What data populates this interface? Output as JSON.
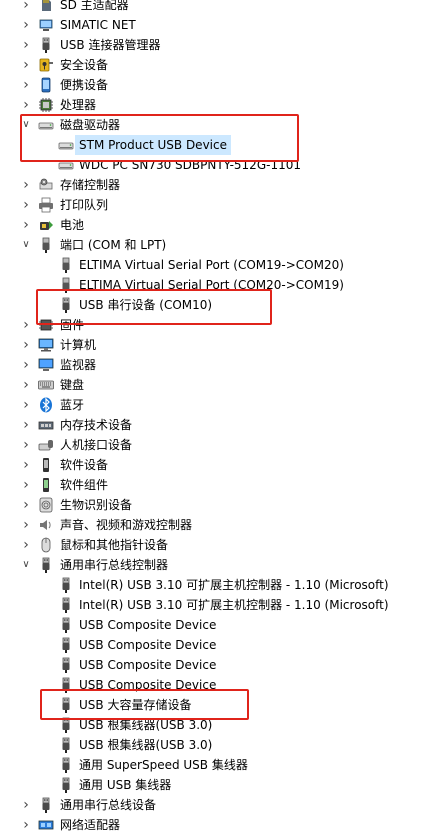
{
  "rows": [
    {
      "level": 0,
      "exp": "c",
      "icon": "sd-card-icon",
      "label": "SD 主适配器"
    },
    {
      "level": 0,
      "exp": "c",
      "icon": "network-icon",
      "label": "SIMATIC NET"
    },
    {
      "level": 0,
      "exp": "c",
      "icon": "usb-device-icon",
      "label": "USB 连接器管理器"
    },
    {
      "level": 0,
      "exp": "c",
      "icon": "security-key-icon",
      "label": "安全设备"
    },
    {
      "level": 0,
      "exp": "c",
      "icon": "portable-device-icon",
      "label": "便携设备"
    },
    {
      "level": 0,
      "exp": "c",
      "icon": "processor-icon",
      "label": "处理器"
    },
    {
      "level": 0,
      "exp": "e",
      "icon": "disk-drive-icon",
      "label": "磁盘驱动器"
    },
    {
      "level": 1,
      "exp": "",
      "icon": "disk-drive-icon",
      "label": "STM Product USB Device",
      "selected": true
    },
    {
      "level": 1,
      "exp": "",
      "icon": "disk-drive-icon",
      "label": "WDC PC SN730 SDBPNTY-512G-1101"
    },
    {
      "level": 0,
      "exp": "c",
      "icon": "storage-controller-icon",
      "label": "存储控制器"
    },
    {
      "level": 0,
      "exp": "c",
      "icon": "printer-icon",
      "label": "打印队列"
    },
    {
      "level": 0,
      "exp": "c",
      "icon": "battery-icon",
      "label": "电池"
    },
    {
      "level": 0,
      "exp": "e",
      "icon": "port-icon",
      "label": "端口 (COM 和 LPT)"
    },
    {
      "level": 1,
      "exp": "",
      "icon": "port-icon",
      "label": "ELTIMA Virtual Serial Port (COM19->COM20)"
    },
    {
      "level": 1,
      "exp": "",
      "icon": "port-icon",
      "label": "ELTIMA Virtual Serial Port (COM20->COM19)"
    },
    {
      "level": 1,
      "exp": "",
      "icon": "usb-device-icon",
      "label": "USB 串行设备 (COM10)"
    },
    {
      "level": 0,
      "exp": "c",
      "icon": "firmware-icon",
      "label": "固件"
    },
    {
      "level": 0,
      "exp": "c",
      "icon": "computer-icon",
      "label": "计算机"
    },
    {
      "level": 0,
      "exp": "c",
      "icon": "monitor-icon",
      "label": "监视器"
    },
    {
      "level": 0,
      "exp": "c",
      "icon": "keyboard-icon",
      "label": "键盘"
    },
    {
      "level": 0,
      "exp": "c",
      "icon": "bluetooth-icon",
      "label": "蓝牙"
    },
    {
      "level": 0,
      "exp": "c",
      "icon": "memory-tech-icon",
      "label": "内存技术设备"
    },
    {
      "level": 0,
      "exp": "c",
      "icon": "hid-icon",
      "label": "人机接口设备"
    },
    {
      "level": 0,
      "exp": "c",
      "icon": "software-device-icon",
      "label": "软件设备"
    },
    {
      "level": 0,
      "exp": "c",
      "icon": "software-component-icon",
      "label": "软件组件"
    },
    {
      "level": 0,
      "exp": "c",
      "icon": "biometric-icon",
      "label": "生物识别设备"
    },
    {
      "level": 0,
      "exp": "c",
      "icon": "speaker-icon",
      "label": "声音、视频和游戏控制器"
    },
    {
      "level": 0,
      "exp": "c",
      "icon": "mouse-icon",
      "label": "鼠标和其他指针设备"
    },
    {
      "level": 0,
      "exp": "e",
      "icon": "usb-device-icon",
      "label": "通用串行总线控制器"
    },
    {
      "level": 1,
      "exp": "",
      "icon": "usb-device-icon",
      "label": "Intel(R) USB 3.10 可扩展主机控制器 - 1.10 (Microsoft)"
    },
    {
      "level": 1,
      "exp": "",
      "icon": "usb-device-icon",
      "label": "Intel(R) USB 3.10 可扩展主机控制器 - 1.10 (Microsoft)"
    },
    {
      "level": 1,
      "exp": "",
      "icon": "usb-device-icon",
      "label": "USB Composite Device"
    },
    {
      "level": 1,
      "exp": "",
      "icon": "usb-device-icon",
      "label": "USB Composite Device"
    },
    {
      "level": 1,
      "exp": "",
      "icon": "usb-device-icon",
      "label": "USB Composite Device"
    },
    {
      "level": 1,
      "exp": "",
      "icon": "usb-device-icon",
      "label": "USB Composite Device"
    },
    {
      "level": 1,
      "exp": "",
      "icon": "usb-device-icon",
      "label": "USB 大容量存储设备"
    },
    {
      "level": 1,
      "exp": "",
      "icon": "usb-device-icon",
      "label": "USB 根集线器(USB 3.0)"
    },
    {
      "level": 1,
      "exp": "",
      "icon": "usb-device-icon",
      "label": "USB 根集线器(USB 3.0)"
    },
    {
      "level": 1,
      "exp": "",
      "icon": "usb-device-icon",
      "label": "通用 SuperSpeed USB 集线器"
    },
    {
      "level": 1,
      "exp": "",
      "icon": "usb-device-icon",
      "label": "通用 USB 集线器"
    },
    {
      "level": 0,
      "exp": "c",
      "icon": "usb-device-icon",
      "label": "通用串行总线设备"
    },
    {
      "level": 0,
      "exp": "c",
      "icon": "network-adapter-icon",
      "label": "网络适配器"
    }
  ],
  "annotation_color": "#e0241b",
  "selection_color": "#cce8ff"
}
